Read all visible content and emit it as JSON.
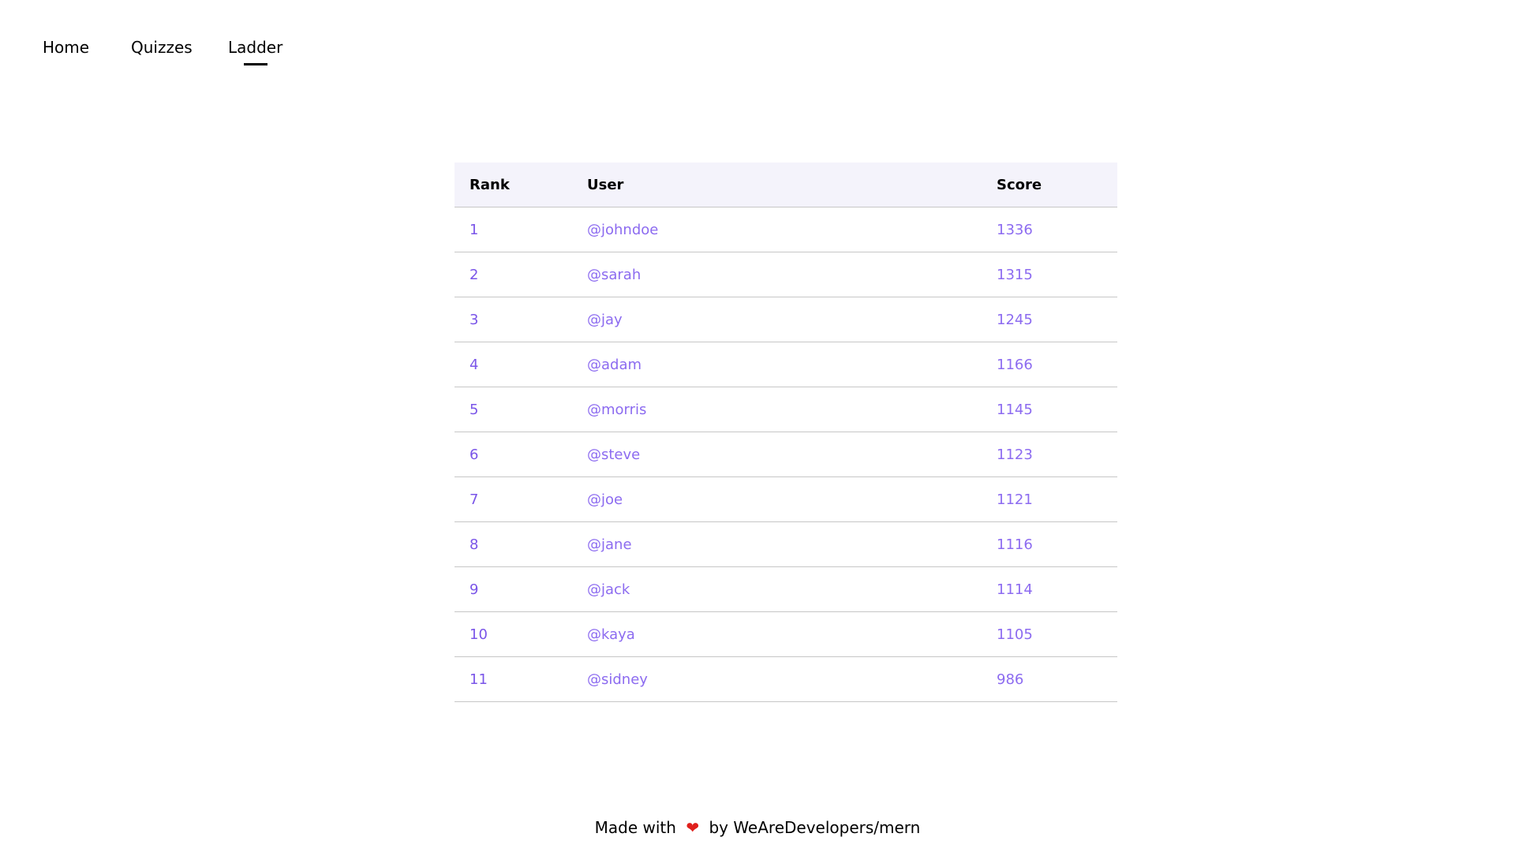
{
  "nav": {
    "items": [
      {
        "label": "Home",
        "active": false
      },
      {
        "label": "Quizzes",
        "active": false
      },
      {
        "label": "Ladder",
        "active": true
      }
    ]
  },
  "ladder": {
    "columns": [
      "Rank",
      "User",
      "Score"
    ],
    "rows": [
      {
        "rank": "1",
        "user": "@johndoe",
        "score": "1336"
      },
      {
        "rank": "2",
        "user": "@sarah",
        "score": "1315"
      },
      {
        "rank": "3",
        "user": "@jay",
        "score": "1245"
      },
      {
        "rank": "4",
        "user": "@adam",
        "score": "1166"
      },
      {
        "rank": "5",
        "user": "@morris",
        "score": "1145"
      },
      {
        "rank": "6",
        "user": "@steve",
        "score": "1123"
      },
      {
        "rank": "7",
        "user": "@joe",
        "score": "1121"
      },
      {
        "rank": "8",
        "user": "@jane",
        "score": "1116"
      },
      {
        "rank": "9",
        "user": "@jack",
        "score": "1114"
      },
      {
        "rank": "10",
        "user": "@kaya",
        "score": "1105"
      },
      {
        "rank": "11",
        "user": "@sidney",
        "score": "986"
      }
    ]
  },
  "footer": {
    "prefix": "Made with",
    "heart_icon": "heart-icon",
    "heart_glyph": "❤",
    "suffix": "by WeAreDevelopers/mern"
  },
  "colors": {
    "accent": "#8c6bf0",
    "header_bg": "#f4f3fb",
    "heart": "#e0201c"
  }
}
